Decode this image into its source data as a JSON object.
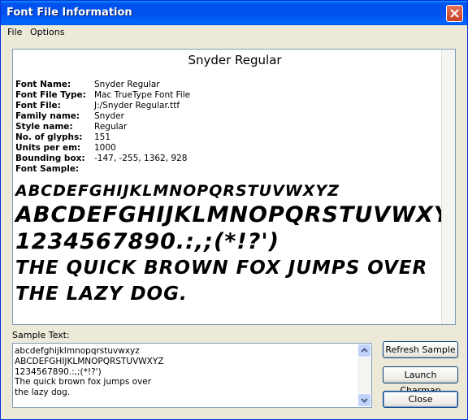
{
  "window": {
    "title": "Font File Information"
  },
  "menu": {
    "file": "File",
    "options": "Options"
  },
  "font_info": {
    "display_name": "Snyder Regular",
    "rows": [
      {
        "label": "Font Name:",
        "value": "Snyder Regular"
      },
      {
        "label": "Font File Type:",
        "value": "Mac TrueType Font File"
      },
      {
        "label": "Font File:",
        "value": "J:/Snyder Regular.ttf"
      },
      {
        "label": "Family name:",
        "value": "Snyder"
      },
      {
        "label": "Style name:",
        "value": "Regular"
      },
      {
        "label": "No. of glyphs:",
        "value": "151"
      },
      {
        "label": "Units per em:",
        "value": "1000"
      },
      {
        "label": "Bounding box:",
        "value": "-147, -255, 1362, 928"
      },
      {
        "label": "Font Sample:",
        "value": ""
      }
    ],
    "samples": [
      "ABCDEFGHIJKLMNOPQRSTUVWXYZ",
      "ABCDEFGHIJKLMNOPQRSTUVWXYZ",
      "1234567890.:,;(*!?')",
      "THE QUICK BROWN FOX JUMPS OVER",
      "THE LAZY DOG."
    ]
  },
  "sample_text": {
    "label": "Sample Text:",
    "value": "abcdefghijklmnopqrstuvwxyz\nABCDEFGHIJKLMNOPQRSTUVWXYZ\n1234567890.:,;(*!?')\nThe quick brown fox jumps over\nthe lazy dog."
  },
  "buttons": {
    "refresh": "Refresh Sample",
    "charmap": "Launch Charmap",
    "close": "Close"
  }
}
